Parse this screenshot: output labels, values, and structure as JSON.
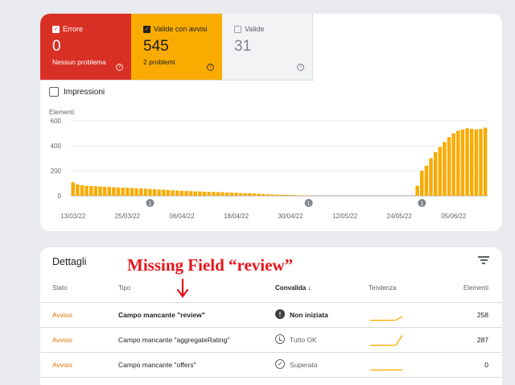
{
  "summary": {
    "error": {
      "label": "Errore",
      "value": "0",
      "sub": "Nessun problema"
    },
    "warning": {
      "label": "Valide con avvisi",
      "value": "545",
      "sub": "2 problemi"
    },
    "valid": {
      "label": "Valide",
      "value": "31"
    }
  },
  "impressions_label": "Impressioni",
  "chart_data": {
    "type": "bar",
    "ylabel": "Elementi",
    "yticks": [
      0,
      200,
      400,
      600
    ],
    "ylim": [
      0,
      600
    ],
    "x_ticks": [
      "13/03/22",
      "25/03/22",
      "06/04/22",
      "18/04/22",
      "30/04/22",
      "12/05/22",
      "24/05/22",
      "05/06/22"
    ],
    "x_tick_index": [
      0,
      12,
      24,
      36,
      48,
      60,
      72,
      84
    ],
    "annotation_index": [
      17,
      52,
      77
    ],
    "annotation_label": "1",
    "color": "#f9ab00",
    "values": [
      108,
      90,
      84,
      80,
      78,
      76,
      74,
      72,
      70,
      68,
      66,
      65,
      63,
      61,
      60,
      58,
      56,
      54,
      52,
      50,
      48,
      46,
      44,
      42,
      40,
      38,
      37,
      35,
      34,
      32,
      31,
      30,
      29,
      28,
      26,
      25,
      24,
      22,
      21,
      20,
      18,
      17,
      14,
      12,
      10,
      9,
      8,
      7,
      6,
      5,
      4,
      3,
      3,
      0,
      0,
      0,
      0,
      0,
      0,
      0,
      0,
      0,
      0,
      0,
      0,
      0,
      0,
      0,
      0,
      0,
      0,
      0,
      0,
      0,
      0,
      0,
      80,
      200,
      240,
      300,
      350,
      390,
      430,
      470,
      500,
      520,
      530,
      540,
      535,
      530,
      535,
      545
    ]
  },
  "details": {
    "title": "Dettagli",
    "annotation": "Missing Field “review”",
    "headers": {
      "stato": "Stato",
      "tipo": "Tipo",
      "convalida": "Convalida",
      "tendenza": "Tendenza",
      "elementi": "Elementi"
    },
    "rows": [
      {
        "stato": "Avviso",
        "tipo": "Campo mancante \"review\"",
        "convalida": "Non iniziata",
        "elementi": "258",
        "spark": [
          0.02,
          0.03,
          0.02,
          0.03,
          0.04,
          0.35
        ]
      },
      {
        "stato": "Avviso",
        "tipo": "Campo mancante \"aggregateRating\"",
        "convalida": "Tutto OK",
        "elementi": "287",
        "spark": [
          0.02,
          0.02,
          0.02,
          0.03,
          0.03,
          0.9
        ]
      },
      {
        "stato": "Avviso",
        "tipo": "Campo mancante \"offers\"",
        "convalida": "Superata",
        "elementi": "0",
        "spark": [
          0.04,
          0.04,
          0.04,
          0.04,
          0.04,
          0.04
        ]
      }
    ]
  }
}
